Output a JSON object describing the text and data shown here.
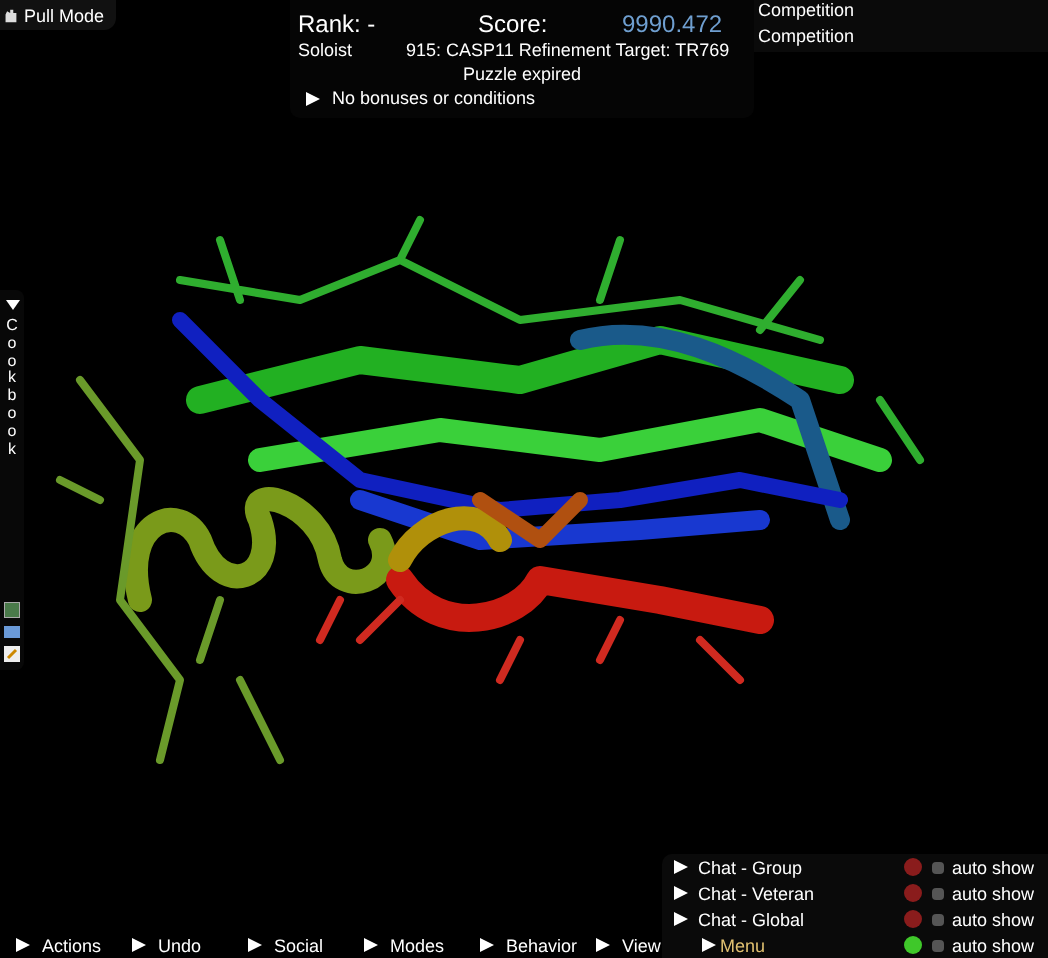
{
  "mode_button": {
    "label": "Pull Mode"
  },
  "score_panel": {
    "rank": "Rank: -",
    "score_label": "Score:",
    "score": "9990.472",
    "player_type": "Soloist",
    "puzzle": "915: CASP11 Refinement Target: TR769",
    "status": "Puzzle expired",
    "conditions": "No bonuses or conditions"
  },
  "competitions": [
    "Competition",
    "Competition"
  ],
  "cookbook": {
    "label": "Cookbook",
    "expanded": true
  },
  "chat_panel": [
    {
      "kind": "chat",
      "label": "Chat - Group",
      "color": "#8a1c1c",
      "auto_show": false,
      "auto_show_label": "auto show"
    },
    {
      "kind": "chat",
      "label": "Chat - Veteran",
      "color": "#8a1c1c",
      "auto_show": false,
      "auto_show_label": "auto show"
    },
    {
      "kind": "chat",
      "label": "Chat - Global",
      "color": "#8a1c1c",
      "auto_show": false,
      "auto_show_label": "auto show"
    },
    {
      "kind": "menu",
      "color": "#3fc82a",
      "auto_show": false,
      "auto_show_label": "auto show"
    }
  ],
  "bottom_menu": [
    "Actions",
    "Undo",
    "Social",
    "Modes",
    "Behavior",
    "View"
  ],
  "menu_button": {
    "label": "Menu"
  }
}
